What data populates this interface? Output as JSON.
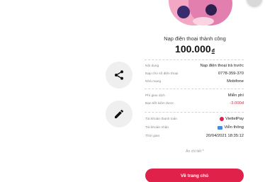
{
  "header": {
    "title": "Nạp điện thoại thành công",
    "amount": "100.000",
    "currency": "đ"
  },
  "details": [
    {
      "label": "Nội dung",
      "value": "Nạp điện thoại trả trước"
    },
    {
      "label": "Nạp cho số điện thoại",
      "value": "0778-359-370"
    },
    {
      "label": "Nhà mạng",
      "value": "Mobifone"
    }
  ],
  "fees": [
    {
      "label": "Phí giao dịch",
      "value": "Miễn phí"
    },
    {
      "label": "Bạn tiết kiệm được",
      "value": "-3.000đ"
    }
  ],
  "accounts": [
    {
      "label": "Tài khoản thanh toán",
      "value": "ViettelPay",
      "icon": "viettelpay-icon"
    },
    {
      "label": "Tài khoản nhận",
      "value": "Viễn thông",
      "icon": "wallet-icon"
    },
    {
      "label": "Thời gian",
      "value": "20/04/2021 18:35:12"
    }
  ],
  "collapse_label": "Ẩn chi tiết ^",
  "home_button_label": "Về trang chủ",
  "side_actions": {
    "share": "share-icon",
    "edit": "edit-icon"
  },
  "colors": {
    "accent": "#e0224a",
    "discount": "#e0224a"
  }
}
